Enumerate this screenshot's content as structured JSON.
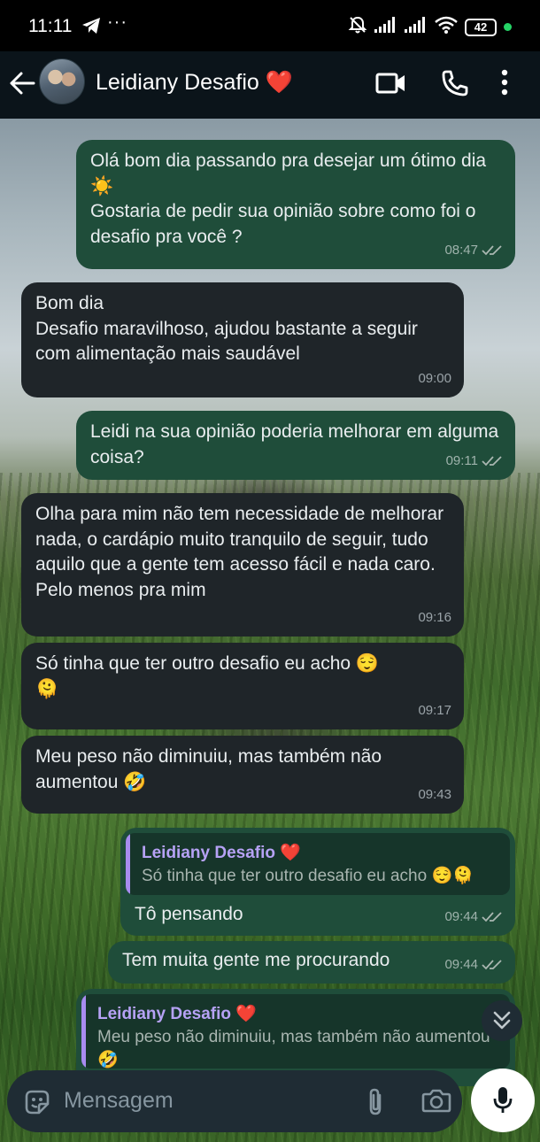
{
  "status_bar": {
    "time": "11:11",
    "dots": "···",
    "battery": "42"
  },
  "header": {
    "contact_name": "Leidiany Desafio ❤️"
  },
  "messages": [
    {
      "direction": "out",
      "text": "Olá bom dia passando pra desejar um ótimo dia ☀️\nGostaria de pedir sua opinião sobre como foi o desafio pra você ?",
      "time": "08:47",
      "read": true
    },
    {
      "direction": "in",
      "text": "Bom dia\nDesafio maravilhoso, ajudou bastante a seguir com alimentação mais saudável",
      "time": "09:00"
    },
    {
      "direction": "out",
      "text": "Leidi na sua opinião poderia melhorar em alguma coisa?",
      "time": "09:11",
      "read": true
    },
    {
      "direction": "in",
      "text": "Olha para mim não tem necessidade de melhorar nada, o cardápio muito tranquilo de seguir, tudo aquilo que a gente tem acesso fácil e nada caro. Pelo menos pra mim",
      "time": "09:16"
    },
    {
      "direction": "in",
      "text": "Só tinha que ter outro desafio eu acho 😌\n🫠",
      "time": "09:17"
    },
    {
      "direction": "in",
      "text": "Meu peso não diminuiu, mas também não aumentou 🤣",
      "time": "09:43"
    },
    {
      "direction": "out",
      "quote": {
        "name": "Leidiany Desafio ❤️",
        "text": "Só tinha que ter outro desafio eu acho 😌🫠"
      },
      "text": "Tô pensando",
      "time": "09:44",
      "read": true
    },
    {
      "direction": "out",
      "text": "Tem muita gente me procurando",
      "time": "09:44",
      "read": true
    },
    {
      "direction": "out",
      "quote": {
        "name": "Leidiany Desafio ❤️",
        "text": "Meu peso não diminuiu, mas também não aumentou 🤣"
      },
      "text": "",
      "time": ""
    }
  ],
  "input": {
    "placeholder": "Mensagem"
  },
  "colors": {
    "outgoing_bubble": "#1f4d3a",
    "incoming_bubble": "#1f2529",
    "quote_accent": "#a88cf0",
    "header_bg": "#0b141a"
  }
}
